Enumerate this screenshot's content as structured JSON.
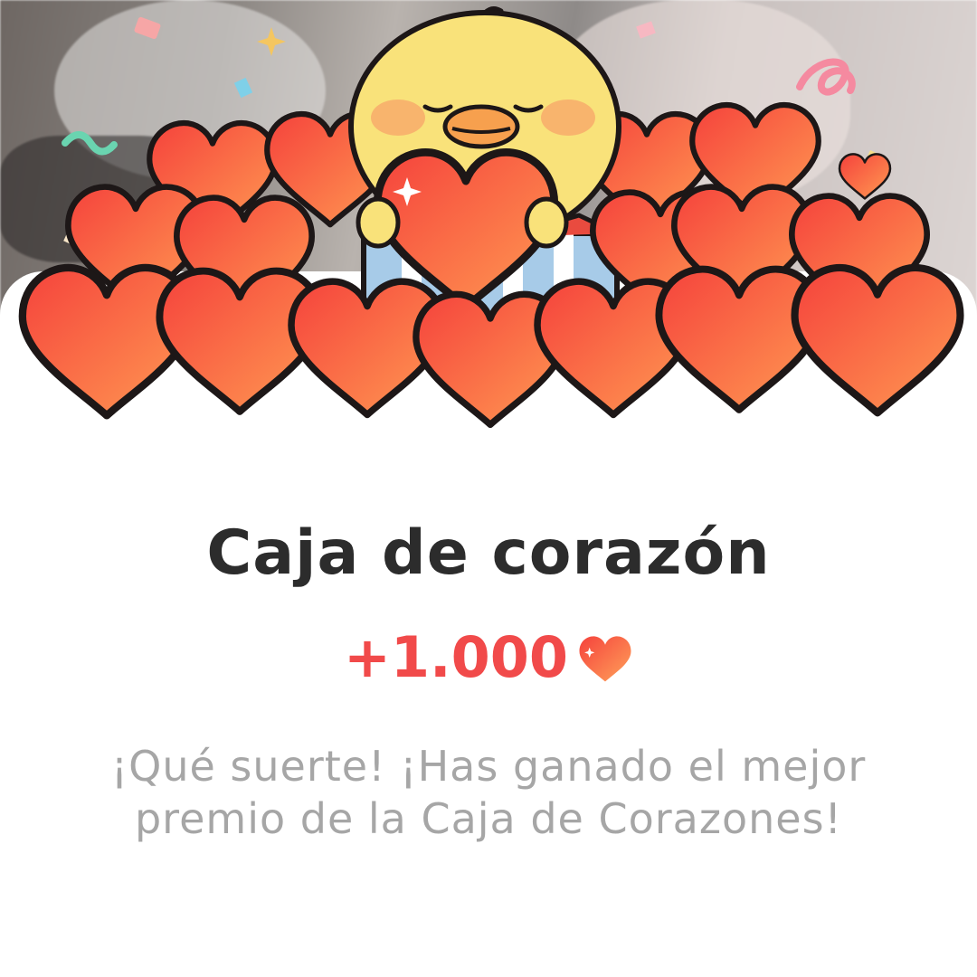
{
  "dialog": {
    "title": "Caja de corazón",
    "amount": "+1.000",
    "amount_icon": "heart-icon",
    "message": "¡Qué suerte! ¡Has ganado el mejor premio de la Caja de Corazones!"
  },
  "illustration": {
    "subject": "chick-holding-heart",
    "heart_icon": "heart-icon",
    "box_icon": "gift-box-icon"
  },
  "colors": {
    "title": "#2c2c2c",
    "amount": "#f14a4a",
    "message": "#a6a6a6",
    "heart_light": "#ff8a4c",
    "heart_dark": "#f2443d",
    "chick": "#f9e27a"
  }
}
